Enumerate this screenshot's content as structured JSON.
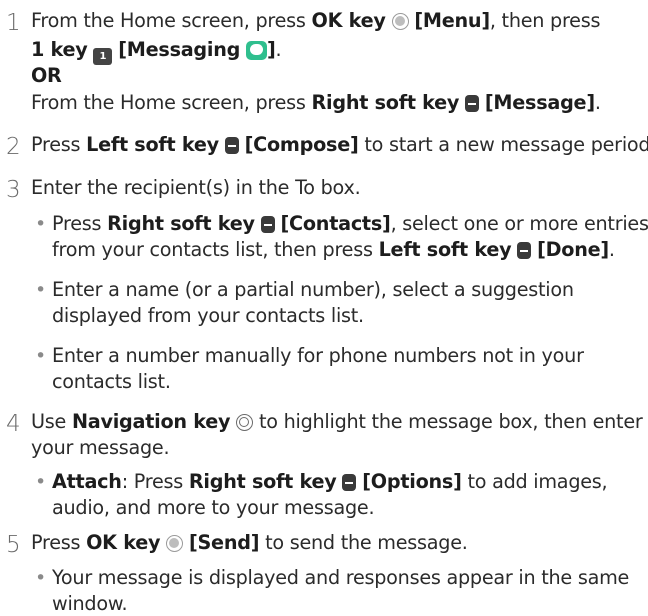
{
  "steps": {
    "s1": {
      "number": "1",
      "l1a": "From the Home screen, press ",
      "l1b": "OK key",
      "l1c": "[Menu]",
      "l1d": ", then press",
      "l2a": "1 key",
      "l2b": "[Messaging",
      "l2c": "]",
      "l2d": ".",
      "or": "OR",
      "l4a": "From the Home screen, press ",
      "l4b": "Right soft key",
      "l4c": "[Message]",
      "l4d": "."
    },
    "s2": {
      "number": "2",
      "a": "Press ",
      "b": "Left soft key",
      "c": "[Compose]",
      "d": " to start a new message period."
    },
    "s3": {
      "number": "3",
      "text": "Enter the recipient(s) in the To box.",
      "b1": {
        "a": "Press ",
        "b": "Right soft key",
        "c": "[Contacts]",
        "d": ", select one or more entries",
        "e": "from your contacts list, then press ",
        "f": "Left soft key",
        "g": "[Done]",
        "h": "."
      },
      "b2": {
        "l1": "Enter a name (or a partial number), select a suggestion",
        "l2": "displayed from your contacts list."
      },
      "b3": {
        "l1": "Enter a number manually for phone numbers not in your",
        "l2": "contacts list."
      }
    },
    "s4": {
      "number": "4",
      "a": "Use ",
      "b": "Navigation key",
      "c": " to highlight the message box, then enter",
      "d": "your message.",
      "b1": {
        "a": "Attach",
        "b": ": Press ",
        "c": "Right soft key",
        "d": "[Options]",
        "e": " to add images,",
        "f": "audio, and more to your message."
      }
    },
    "s5": {
      "number": "5",
      "a": "Press ",
      "b": "OK key",
      "c": "[Send]",
      "d": " to send the message.",
      "b1": {
        "l1": "Your message is displayed and responses appear in the same",
        "l2": "window."
      }
    }
  },
  "icons": {
    "ok_key": "ok-key-icon",
    "soft_key": "soft-key-icon",
    "nav_key": "navigation-key-icon",
    "key_1": "1-key-icon",
    "key_1_label": "1",
    "messaging": "messaging-app-icon"
  },
  "colors": {
    "text": "#2b2b2b",
    "step_number": "#6a6a6a",
    "messaging_icon": "#2fbf8e"
  }
}
